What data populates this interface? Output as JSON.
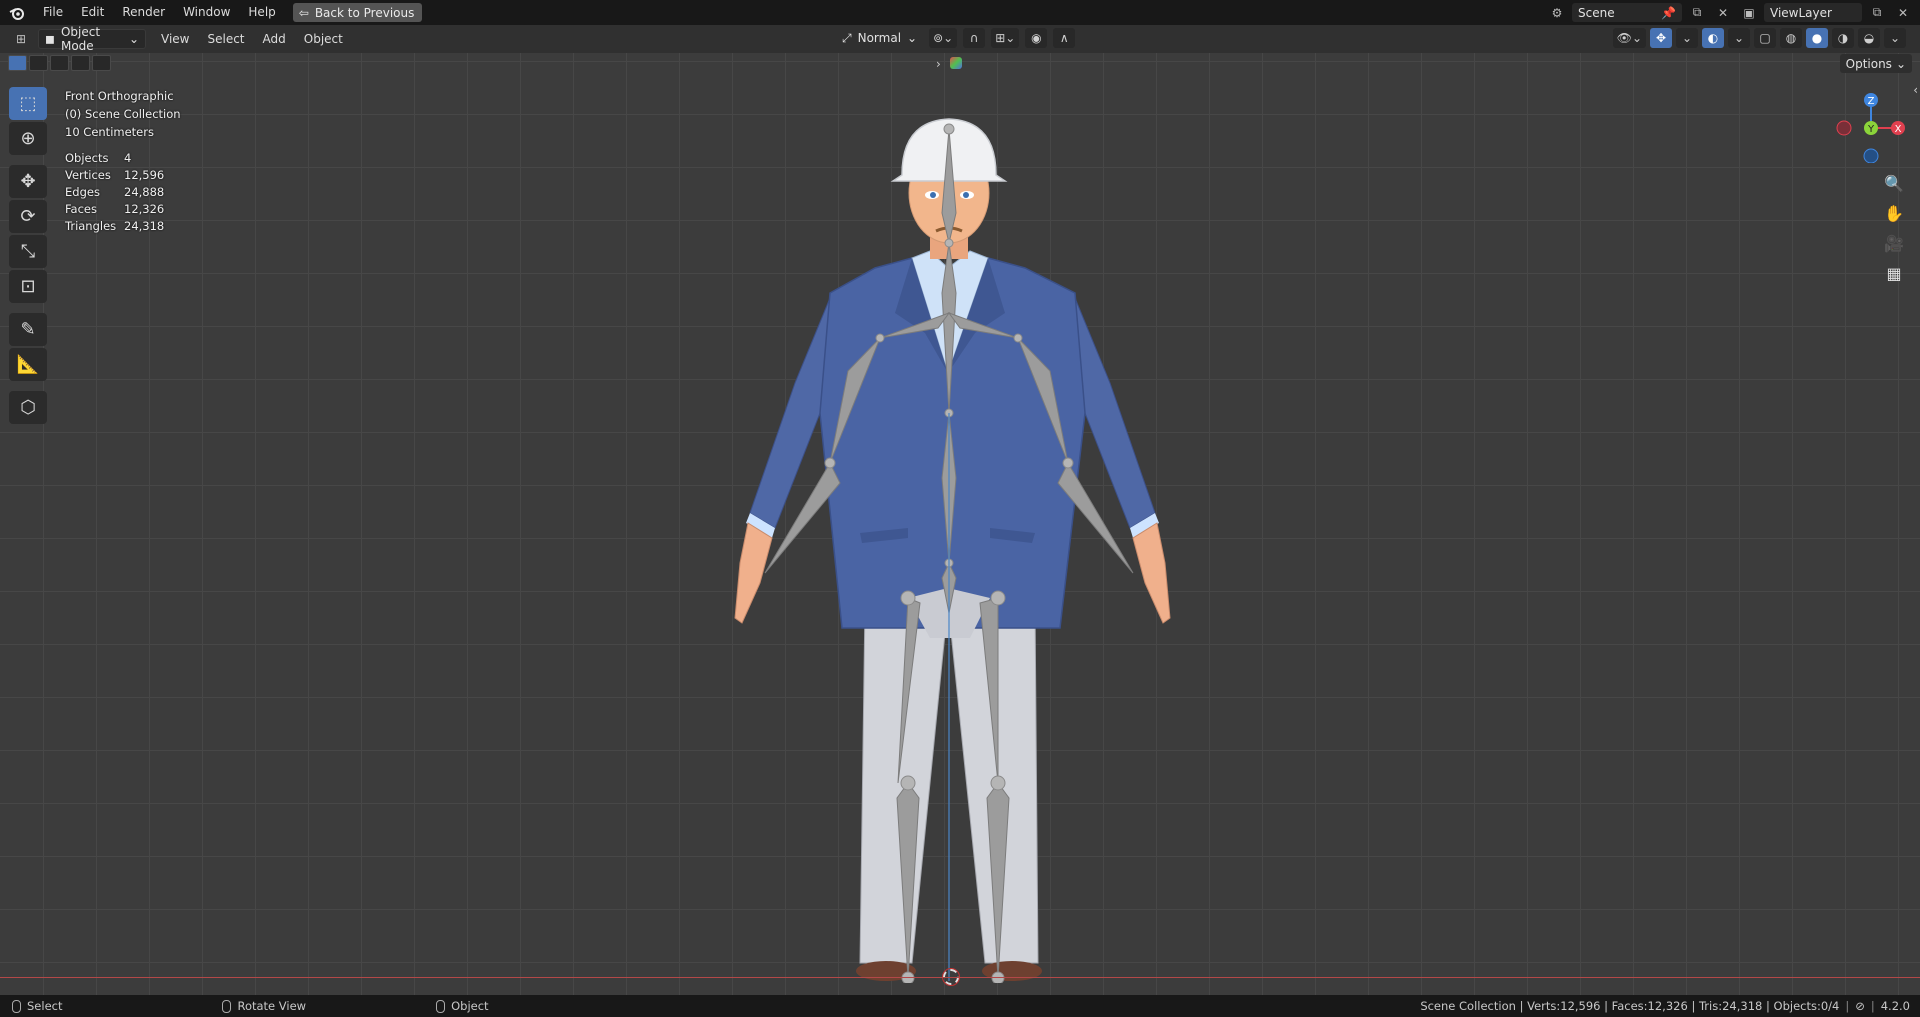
{
  "topbar": {
    "menus": [
      "File",
      "Edit",
      "Render",
      "Window",
      "Help"
    ],
    "back_button": "Back to Previous",
    "scene": "Scene",
    "view_layer": "ViewLayer"
  },
  "viewport_header": {
    "mode": "Object Mode",
    "menus": [
      "View",
      "Select",
      "Add",
      "Object"
    ],
    "transform_orientation": "Normal",
    "options": "Options"
  },
  "overlay": {
    "view_name": "Front Orthographic",
    "collection": "(0) Scene Collection",
    "scale": "10 Centimeters"
  },
  "stats": [
    {
      "label": "Objects",
      "value": "4"
    },
    {
      "label": "Vertices",
      "value": "12,596"
    },
    {
      "label": "Edges",
      "value": "24,888"
    },
    {
      "label": "Faces",
      "value": "12,326"
    },
    {
      "label": "Triangles",
      "value": "24,318"
    }
  ],
  "gizmo": {
    "z": "Z",
    "y": "Y",
    "x": "X"
  },
  "statusbar": {
    "select": "Select",
    "rotate": "Rotate View",
    "object": "Object",
    "info": "Scene Collection | Verts:12,596 | Faces:12,326 | Tris:24,318 | Objects:0/4",
    "version": "4.2.0"
  },
  "colors": {
    "accent": "#4772b3",
    "x_axis": "#e0404f",
    "y_axis": "#8bd43a",
    "z_axis": "#3f86e0"
  }
}
